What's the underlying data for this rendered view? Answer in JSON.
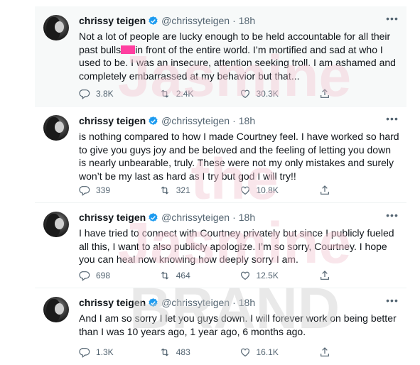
{
  "author": {
    "name": "chrissy teigen",
    "handle": "@chrissyteigen",
    "separator": "·"
  },
  "colors": {
    "verified": "#1d9bf0",
    "redaction": "#ff3fa0",
    "watermark": "#f3c9d4",
    "watermark_gray": "#d0d0d0"
  },
  "watermark": {
    "line1": "Jasmine",
    "line2": "the",
    "line3": "Jasmine",
    "line4": "BRAND"
  },
  "tweets": [
    {
      "time": "18h",
      "text_a": "Not a lot of people are lucky enough to be held accountable for all their past bulls",
      "text_b": "in front of the entire world. I’m mortified and sad at who I used to be. I was an insecure, attention seeking troll. I am ashamed and completely embarrassed at my behavior but that...",
      "replies": "3.8K",
      "retweets": "2.4K",
      "likes": "30.3K"
    },
    {
      "time": "18h",
      "text": "is nothing compared to how I made Courtney feel. I have worked so hard to give you guys joy and be beloved and the feeling of letting you down is nearly unbearable, truly. These were not my only mistakes and surely won’t be my last as hard as I try but god I will try!!",
      "replies": "339",
      "retweets": "321",
      "likes": "10.8K"
    },
    {
      "time": "18h",
      "text": "I have tried to connect with Courtney privately but since I publicly fueled all this, I want to also publicly apologize. I’m so sorry, Courtney. I hope you can heal now knowing how deeply sorry I am.",
      "replies": "698",
      "retweets": "464",
      "likes": "12.5K"
    },
    {
      "time": "18h",
      "text": "And I am so sorry I let you guys down. I will forever work on being better than I was 10 years ago, 1 year ago, 6 months ago.",
      "replies": "1.3K",
      "retweets": "483",
      "likes": "16.1K"
    }
  ],
  "icons": [
    "reply-icon",
    "retweet-icon",
    "like-icon",
    "share-icon",
    "verified-icon",
    "more-icon"
  ]
}
